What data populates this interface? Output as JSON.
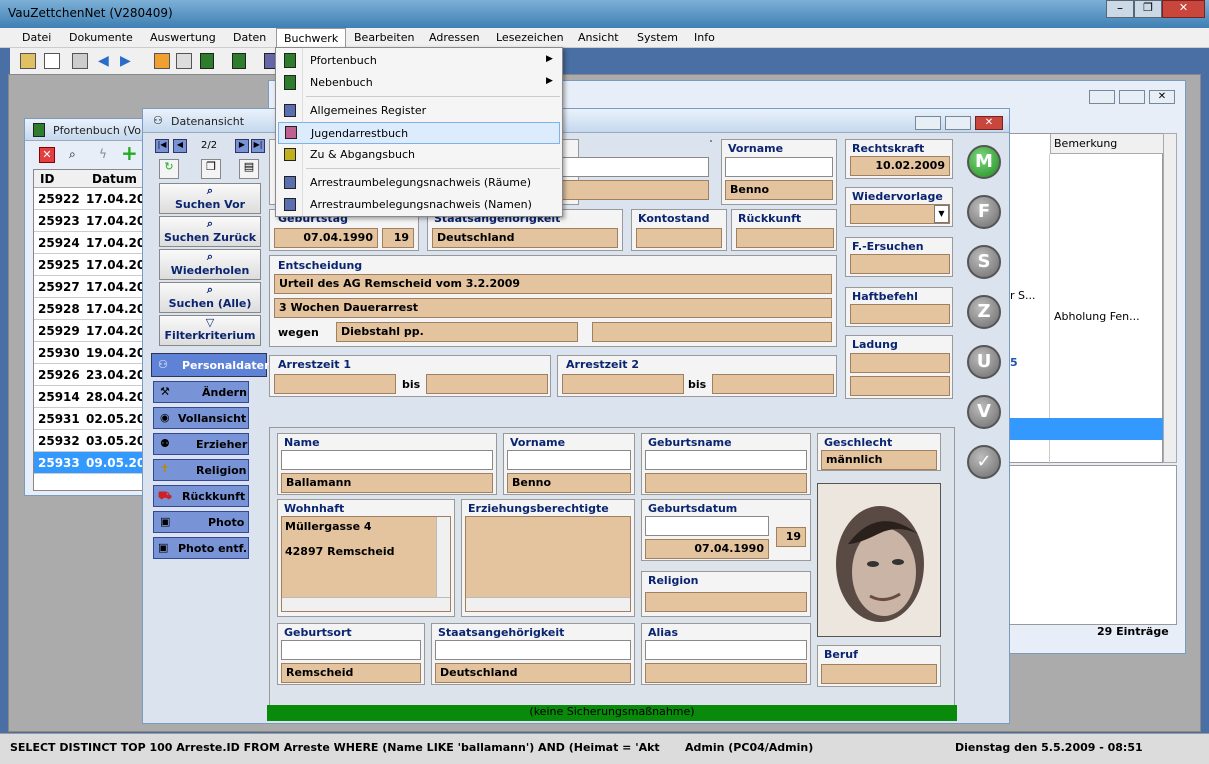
{
  "app": {
    "title": "VauZettchenNet (V280409)"
  },
  "menu": [
    "Datei",
    "Dokumente",
    "Auswertung",
    "Daten",
    "Buchwerk",
    "Bearbeiten",
    "Adressen",
    "Lesezeichen",
    "Ansicht",
    "System",
    "Info"
  ],
  "dropdown": [
    {
      "label": "Pfortenbuch",
      "submenu": true
    },
    {
      "label": "Nebenbuch",
      "submenu": true
    },
    {
      "label": "Allgemeines Register"
    },
    {
      "label": "Jugendarrestbuch"
    },
    {
      "label": "Zu & Abgangsbuch"
    },
    {
      "label": "Arrestraumbelegungsnachweis (Räume)"
    },
    {
      "label": "Arrestraumbelegungsnachweis (Namen)"
    }
  ],
  "pfortenbuch": {
    "title": "Pfortenbuch (Vo",
    "col_id": "ID",
    "col_datum": "Datum",
    "rows": [
      [
        "25922",
        "17.04.200"
      ],
      [
        "25923",
        "17.04.200"
      ],
      [
        "25924",
        "17.04.200"
      ],
      [
        "25925",
        "17.04.200"
      ],
      [
        "25927",
        "17.04.200"
      ],
      [
        "25928",
        "17.04.200"
      ],
      [
        "25929",
        "17.04.200"
      ],
      [
        "25930",
        "19.04.200"
      ],
      [
        "25926",
        "23.04.200"
      ],
      [
        "25914",
        "28.04.200"
      ],
      [
        "25931",
        "02.05.200"
      ],
      [
        "25932",
        "03.05.200"
      ],
      [
        "25933",
        "09.05.200"
      ]
    ]
  },
  "bgwin": {
    "col_bemerkung": "Bemerkung",
    "cell_s": "r S...",
    "cell_abholung": "Abholung Fen...",
    "cell_5": "5",
    "entries": "29 Einträge"
  },
  "datenansicht": {
    "title": "Datenansicht",
    "nav": "2/2",
    "buttons": [
      "Suchen Vor",
      "Suchen Zurück",
      "Wiederholen",
      "Suchen (Alle)",
      "Filterkriterium"
    ],
    "personaldaten": "Personaldaten",
    "sidebuttons": [
      "Ändern",
      "Vollansicht",
      "Erzieher",
      "Religion",
      "Rückkunft",
      "Photo",
      "Photo entf."
    ],
    "top": {
      "vorname_label": "Vorname",
      "vorname": "Benno",
      "rechtskraft_label": "Rechtskraft",
      "rechtskraft": "10.02.2009",
      "wiedervorlage_label": "Wiedervorlage",
      "geburtstag_label": "Geburtstag",
      "geburtstag": "07.04.1990",
      "alter": "19",
      "staatsang_label": "Staatsangehörigkeit",
      "staatsang": "Deutschland",
      "kontostand_label": "Kontostand",
      "rueckkunft_label": "Rückkunft",
      "fersuchen_label": "F.-Ersuchen",
      "entscheidung_label": "Entscheidung",
      "urteil": "Urteil des AG Remscheid vom 3.2.2009",
      "dauer": "3  Wochen Dauerarrest",
      "wegen_label": "wegen",
      "wegen": "Diebstahl pp.",
      "haftbefehl_label": "Haftbefehl",
      "ladung_label": "Ladung",
      "arrest1_label": "Arrestzeit  1",
      "arrest2_label": "Arrestzeit  2",
      "bis": "bis"
    },
    "person": {
      "name_label": "Name",
      "name": "Ballamann",
      "vorname_label": "Vorname",
      "vorname": "Benno",
      "geburtsname_label": "Geburtsname",
      "geschlecht_label": "Geschlecht",
      "geschlecht": "männlich",
      "wohnhaft_label": "Wohnhaft",
      "strasse": "Müllergasse 4",
      "ort": "42897 Remscheid",
      "erzieh_label": "Erziehungsberechtigte",
      "geburtsdatum_label": "Geburtsdatum",
      "geburtsdatum": "07.04.1990",
      "alter": "19",
      "religion_label": "Religion",
      "geburtsort_label": "Geburtsort",
      "geburtsort": "Remscheid",
      "staatsang_label": "Staatsangehörigkeit",
      "staatsang": "Deutschland",
      "alias_label": "Alias",
      "beruf_label": "Beruf"
    },
    "sicherung": "(keine Sicherungsmaßnahme)"
  },
  "statusbar": {
    "sql": "SELECT DISTINCT TOP 100 Arreste.ID FROM Arreste WHERE (Name LIKE 'ballamann') AND (Heimat = 'Akt",
    "user": "Admin (PC04/Admin)",
    "date": "Dienstag den 5.5.2009 - 08:51"
  },
  "circles": [
    "M",
    "F",
    "S",
    "Z",
    "U",
    "V",
    "✓"
  ]
}
